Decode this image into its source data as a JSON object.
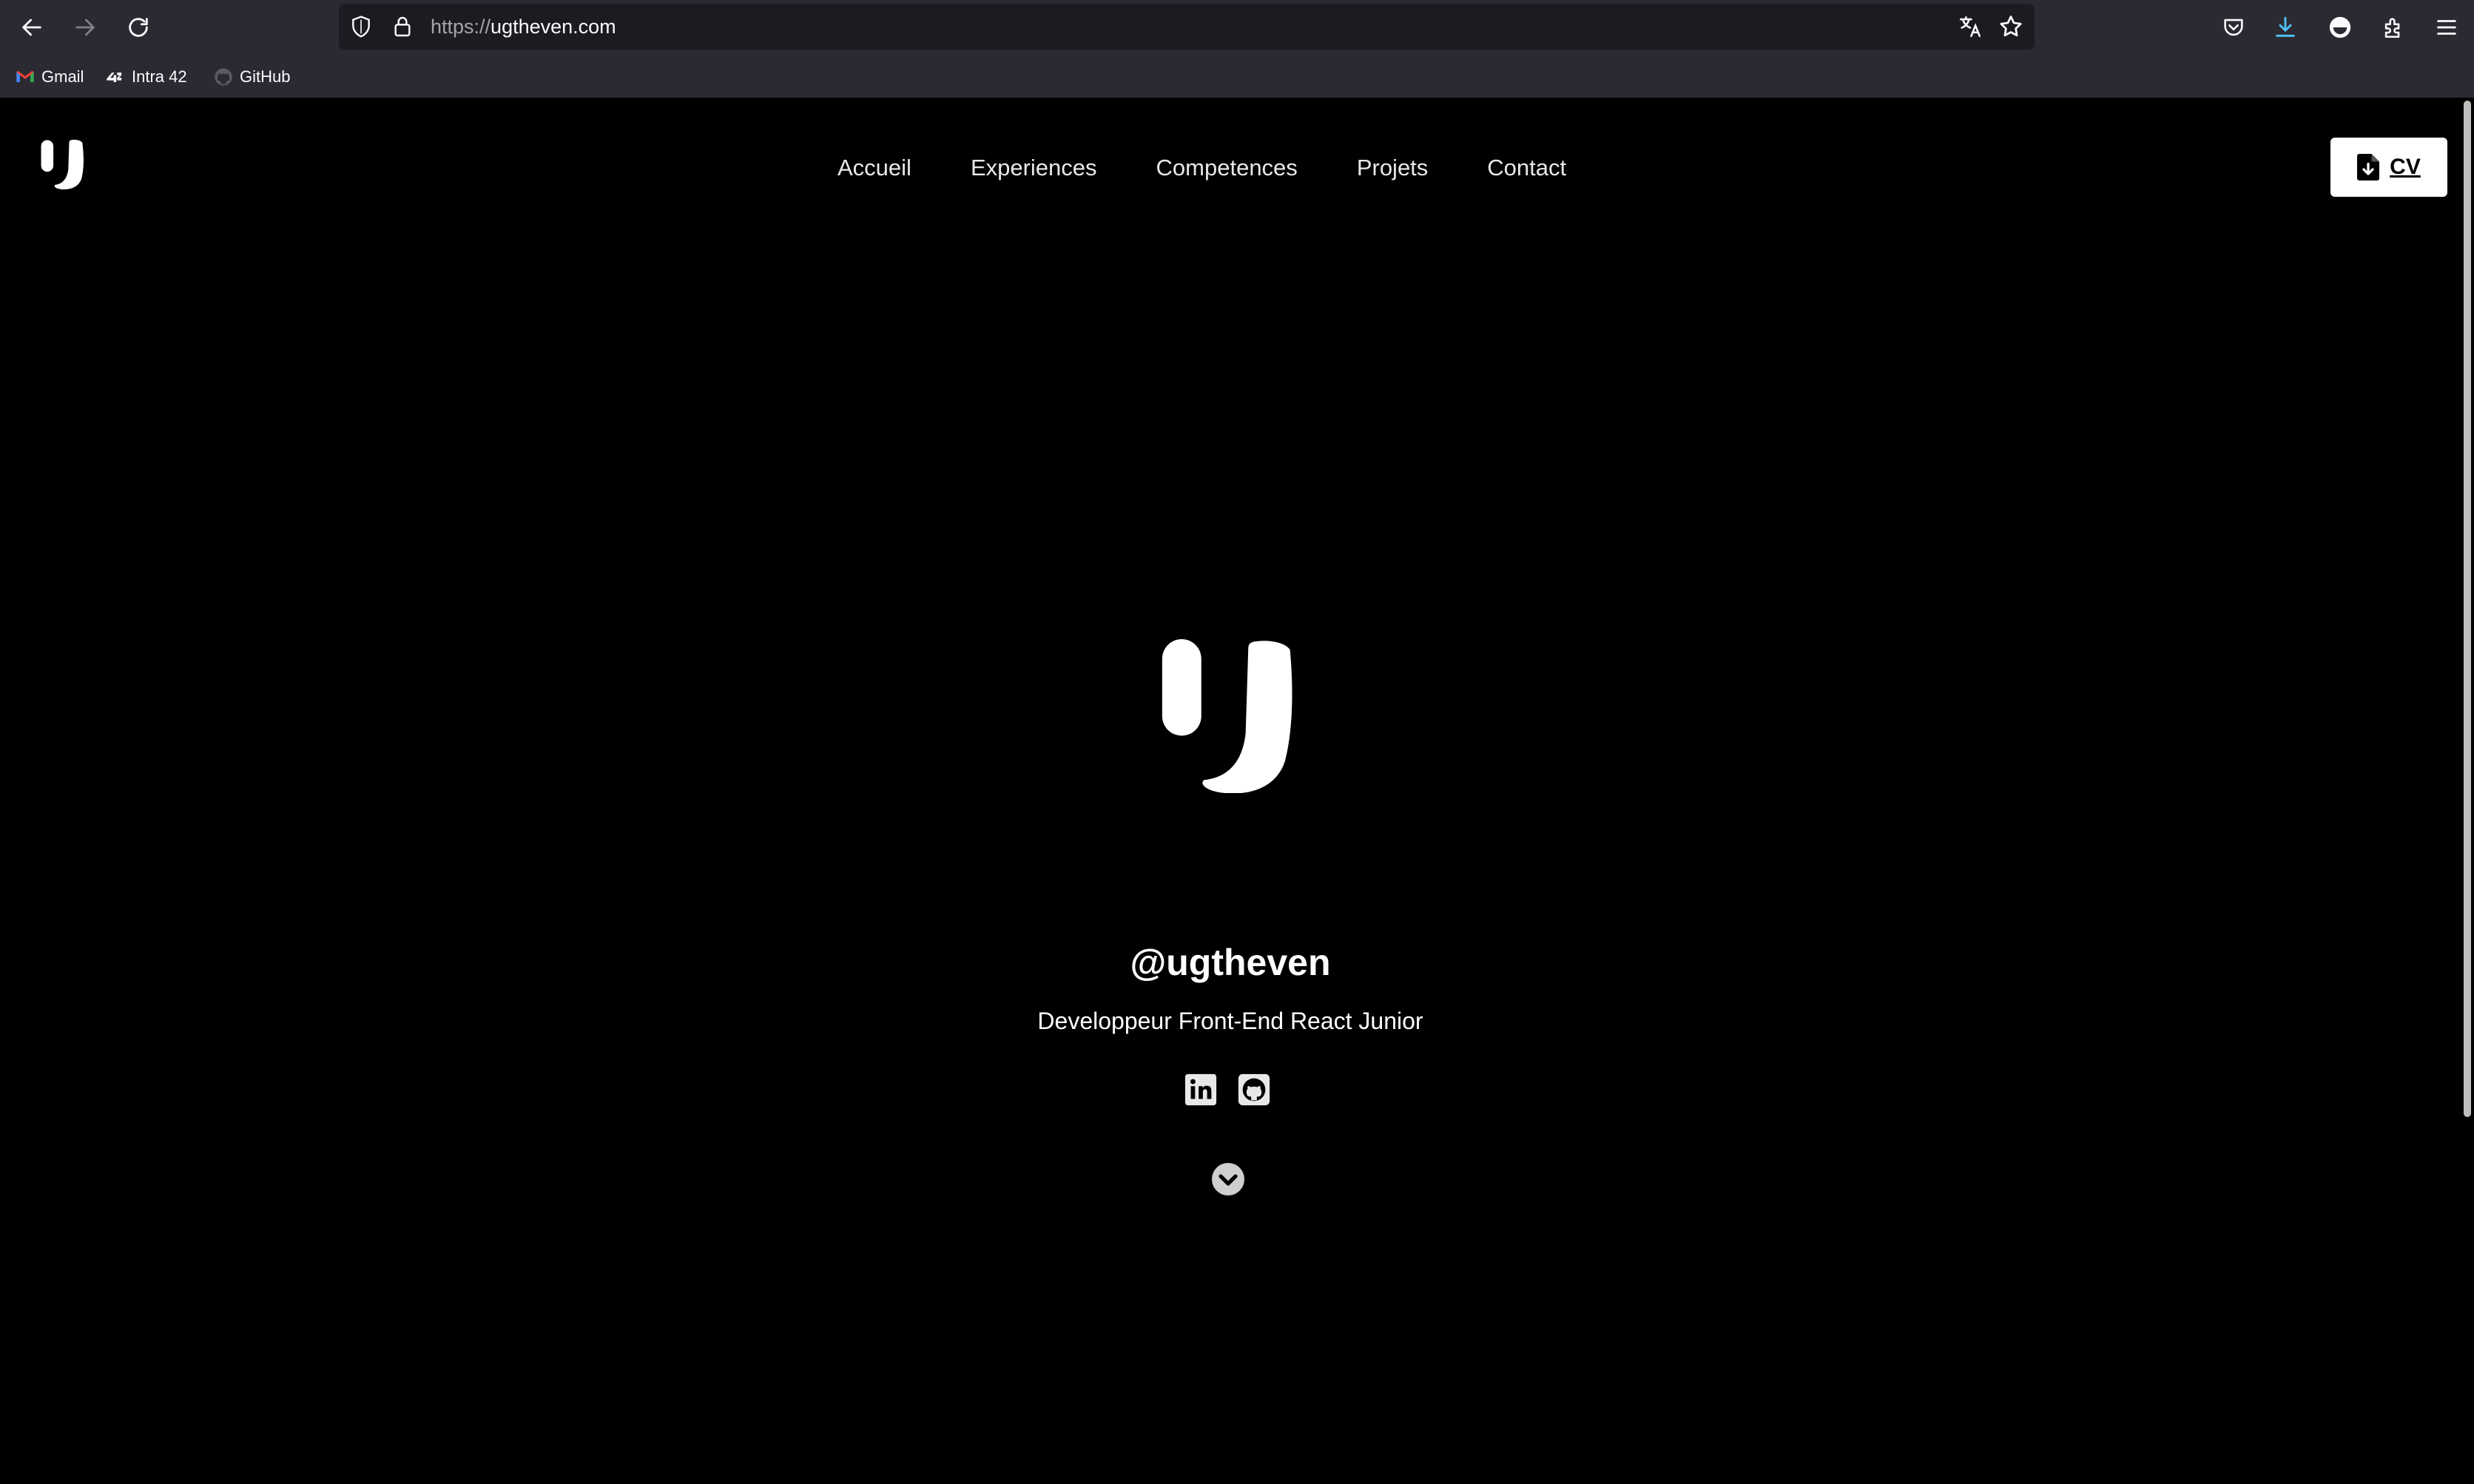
{
  "browser": {
    "url_scheme": "https://",
    "url_host": "ugtheven.com",
    "icons": {
      "back": "back-arrow-icon",
      "forward": "forward-arrow-icon",
      "reload": "reload-icon",
      "shield": "tracking-shield-icon",
      "lock": "lock-icon",
      "translate": "translate-icon",
      "bookmark_star": "star-icon",
      "pocket": "pocket-icon",
      "downloads": "download-icon",
      "account": "account-icon",
      "extensions": "extensions-icon",
      "menu": "hamburger-menu-icon"
    },
    "bookmarks": [
      {
        "label": "Gmail",
        "icon": "gmail-icon"
      },
      {
        "label": "Intra 42",
        "icon": "42-icon"
      },
      {
        "label": "GitHub",
        "icon": "github-icon"
      }
    ]
  },
  "site": {
    "nav": [
      "Accueil",
      "Experiences",
      "Competences",
      "Projets",
      "Contact"
    ],
    "cv_button_label": "CV",
    "handle": "@ugtheven",
    "subtitle": "Developpeur Front-End React Junior",
    "socials": [
      {
        "name": "LinkedIn",
        "icon": "linkedin-icon"
      },
      {
        "name": "GitHub",
        "icon": "github-icon"
      }
    ],
    "colors": {
      "background": "#000000",
      "text": "#ffffff",
      "chrome": "#2b2a33",
      "urlbar": "#1c1b22",
      "download_accent": "#54ffbd"
    }
  }
}
